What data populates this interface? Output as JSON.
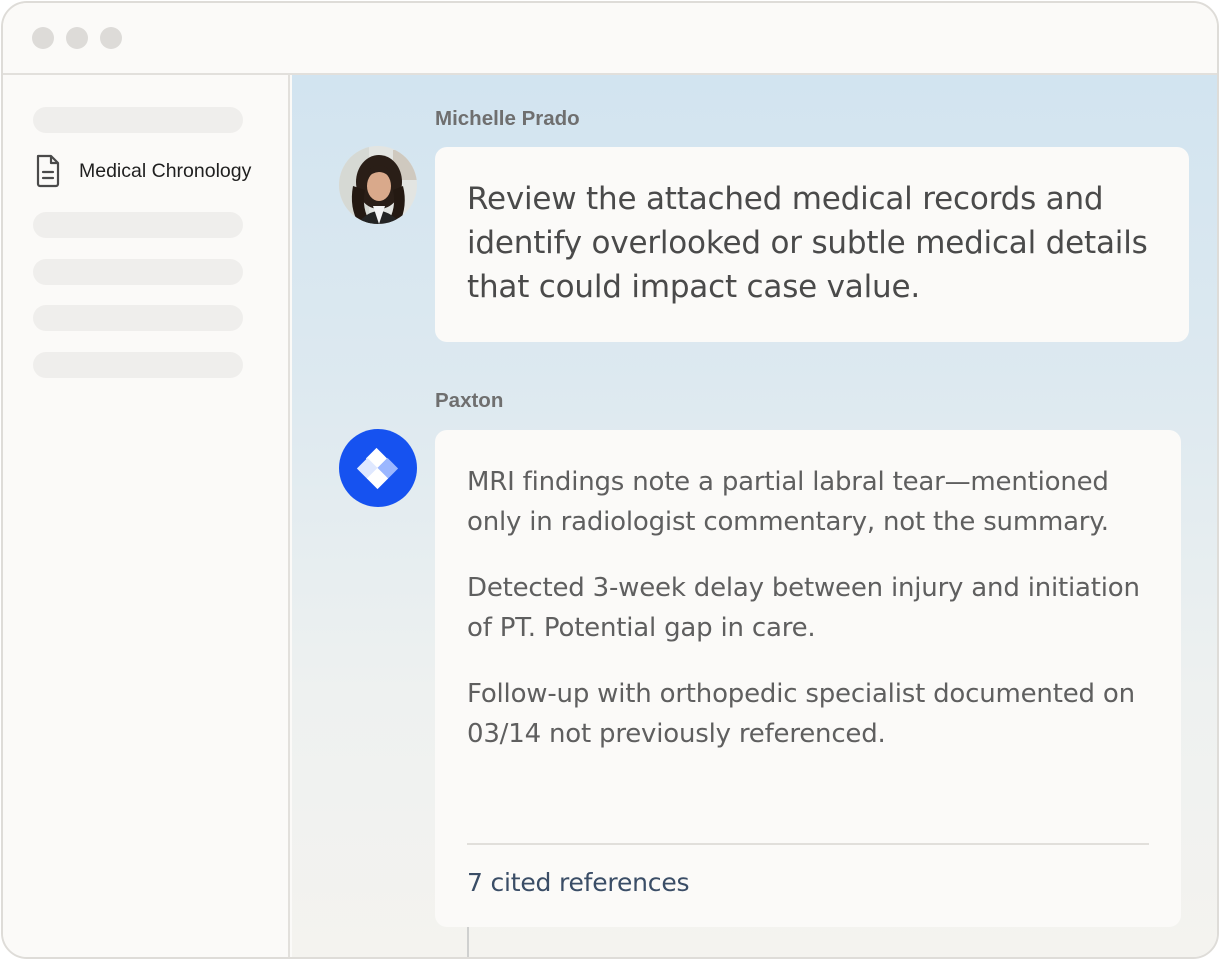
{
  "window": {
    "controls": [
      "close",
      "minimize",
      "maximize"
    ]
  },
  "sidebar": {
    "active_item": {
      "label": "Medical Chronology",
      "icon": "document-icon"
    },
    "placeholder_items": 5
  },
  "conversation": {
    "user_message": {
      "sender": "Michelle Prado",
      "avatar": "user-photo",
      "text": "Review the attached medical records and identify overlooked or subtle medical details that could impact case value."
    },
    "assistant_message": {
      "sender": "Paxton",
      "avatar": "paxton-logo-icon",
      "findings": [
        "MRI findings note a partial labral tear—mentioned only in radiologist commentary, not the summary.",
        "Detected 3-week delay between injury and initiation of PT. Potential gap in care.",
        "Follow-up with orthopedic specialist documented on 03/14 not previously referenced."
      ],
      "references_label": "7 cited references"
    }
  },
  "colors": {
    "brand_blue": "#1652f0",
    "window_bg": "#fbfaf8",
    "link": "#3a4d66"
  }
}
